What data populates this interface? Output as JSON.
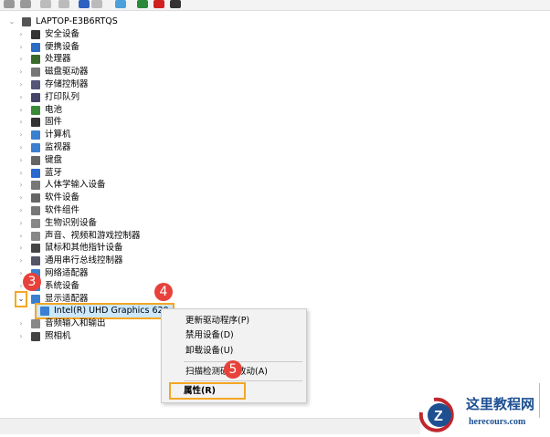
{
  "toolbar": {
    "icons": [
      "back-icon",
      "forward-icon",
      "properties-icon",
      "show-hide-icon",
      "help-icon",
      "view-icon",
      "monitor-icon",
      "update-driver-icon",
      "uninstall-icon",
      "download-icon"
    ]
  },
  "tree": {
    "root": "LAPTOP-E3B6RTQS",
    "items": [
      "安全设备",
      "便携设备",
      "处理器",
      "磁盘驱动器",
      "存储控制器",
      "打印队列",
      "电池",
      "固件",
      "计算机",
      "监视器",
      "键盘",
      "蓝牙",
      "人体学输入设备",
      "软件设备",
      "软件组件",
      "生物识别设备",
      "声音、视频和游戏控制器",
      "鼠标和其他指针设备",
      "通用串行总线控制器",
      "网络适配器",
      "系统设备",
      "显示适配器"
    ],
    "child": "Intel(R) UHD Graphics 620",
    "after": [
      "音频输入和输出",
      "照相机"
    ]
  },
  "menu": {
    "items": [
      "更新驱动程序(P)",
      "禁用设备(D)",
      "卸载设备(U)",
      "扫描检测硬件改动(A)",
      "属性(R)"
    ]
  },
  "badges": [
    "3",
    "4",
    "5"
  ],
  "logo": {
    "title": "这里教程网",
    "url": "herecours.com"
  },
  "colors": {
    "highlight": "#f5a623",
    "badge": "#e8413b",
    "selection": "#cce8ff"
  }
}
